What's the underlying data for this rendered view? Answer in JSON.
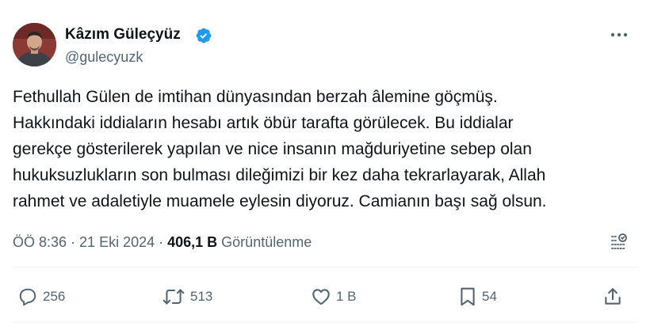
{
  "author": {
    "name": "Kâzım Güleçyüz",
    "handle": "@gulecyuzk",
    "verified": true,
    "verified_color": "#1d9bf0"
  },
  "tweet": {
    "lines": [
      "Fethullah Gülen de imtihan dünyasından berzah âlemine göçmüş.",
      "Hakkındaki iddiaların hesabı artık öbür tarafta görülecek. Bu iddialar",
      "gerekçe gösterilerek yapılan ve nice insanın mağduriyetine sebep olan",
      "hukuksuzlukların son bulması dileğimizi bir kez daha tekrarlayarak, Allah",
      "rahmet ve adaletiyle muamele eylesin diyoruz. Camianın başı sağ olsun."
    ]
  },
  "meta": {
    "time": "ÖÖ 8:36",
    "separator": "·",
    "date": "21 Eki 2024",
    "views_count": "406,1 B",
    "views_label": "Görüntülenme"
  },
  "actions": {
    "reply_count": "256",
    "repost_count": "513",
    "like_count": "1 B",
    "bookmark_count": "54"
  },
  "icons": {
    "more": "more-icon",
    "analytics": "analytics-icon",
    "reply": "reply-icon",
    "repost": "repost-icon",
    "like": "like-icon",
    "bookmark": "bookmark-icon",
    "share": "share-icon"
  },
  "colors": {
    "text": "#0f1419",
    "secondary": "#536471",
    "divider": "#eff3f4"
  }
}
